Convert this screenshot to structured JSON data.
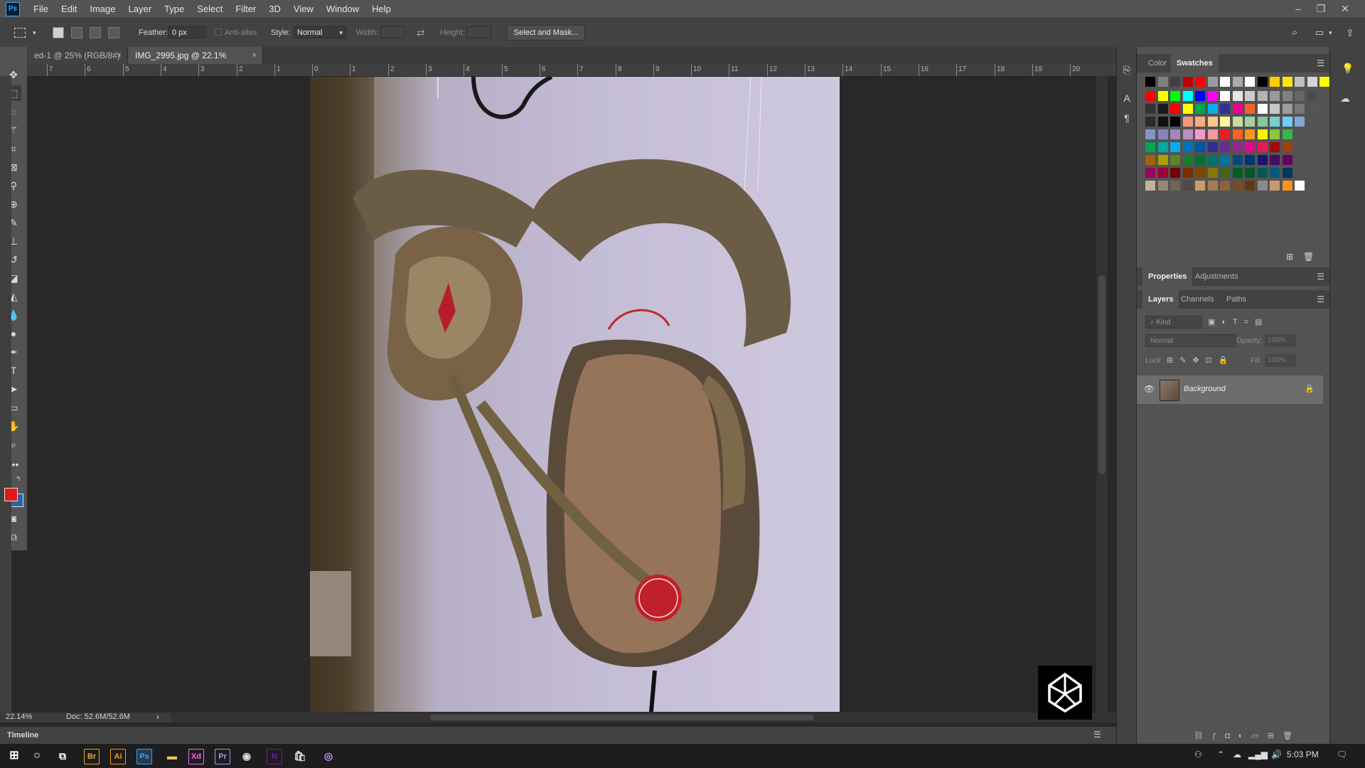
{
  "app": {
    "logo_text": "Ps"
  },
  "menu": [
    "File",
    "Edit",
    "Image",
    "Layer",
    "Type",
    "Select",
    "Filter",
    "3D",
    "View",
    "Window",
    "Help"
  ],
  "window_controls": {
    "minimize": "–",
    "restore": "❐",
    "close": "✕"
  },
  "options_bar": {
    "feather_label": "Feather:",
    "feather_value": "0 px",
    "anti_alias_label": "Anti-alias",
    "style_label": "Style:",
    "style_value": "Normal",
    "width_label": "Width:",
    "height_label": "Height:",
    "select_mask_label": "Select and Mask..."
  },
  "tabs": [
    {
      "label": "ed-1 @ 25% (RGB/8#)",
      "close": "×"
    },
    {
      "label": "IMG_2995.jpg @ 22.1% (RGB/8)",
      "close": "×"
    }
  ],
  "hruler_labels": [
    "7",
    "6",
    "5",
    "4",
    "3",
    "2",
    "1",
    "0",
    "1",
    "2",
    "3",
    "4",
    "5",
    "6",
    "7",
    "8",
    "9",
    "10",
    "11",
    "12",
    "13",
    "14",
    "15",
    "16",
    "17",
    "18",
    "19",
    "20"
  ],
  "status": {
    "zoom": "22.14%",
    "doc": "Doc: 52.6M/52.6M",
    "arrow": "›"
  },
  "timeline": {
    "label": "Timeline"
  },
  "color_panel": {
    "tabs": [
      "Color",
      "Swatches"
    ]
  },
  "swatch_colors": {
    "row1": [
      "#000000",
      "#7f7f7f",
      "#404040",
      "#c00000",
      "#ff0000",
      "#9b9b9b",
      "#ffffff",
      "#aaaaaa",
      "#ffffff",
      "#000000",
      "#ffcc00",
      "#ffe600",
      "#c0c0c0",
      "#d4d4d4",
      "#ffff00"
    ],
    "row2": [
      "#ff0000",
      "#ffff00",
      "#00ff00",
      "#00ffff",
      "#0000ff",
      "#ff00ff",
      "#ffffff",
      "#e6e6e6",
      "#cccccc",
      "#b3b3b3",
      "#999999",
      "#808080",
      "#666666",
      "#4d4d4d"
    ],
    "row3": [
      "#333333",
      "#1a1a1a",
      "#ff0000",
      "#ffff00",
      "#00a651",
      "#00aeef",
      "#2e3192",
      "#ec008c",
      "#f26522",
      "#ffffff",
      "#c7c7c7",
      "#9d9d9d",
      "#777777",
      "#555555"
    ],
    "row4": [
      "#2b2b2b",
      "#111111",
      "#000000",
      "#f7977a",
      "#f9ad81",
      "#fdc68a",
      "#fff79a",
      "#c4df9b",
      "#a2d39c",
      "#82ca9d",
      "#7bcdc8",
      "#6ecff6",
      "#7ea7d8"
    ],
    "row5": [
      "#8493ca",
      "#8882be",
      "#a187be",
      "#bc8dbf",
      "#f49ac2",
      "#f6989d",
      "#ed1c24",
      "#f26522",
      "#f7941d",
      "#fff200",
      "#8dc63f",
      "#39b54a"
    ],
    "row6": [
      "#00a651",
      "#00a99d",
      "#00aeef",
      "#0072bc",
      "#0054a6",
      "#2e3192",
      "#662d91",
      "#92278f",
      "#ec008c",
      "#ed145b",
      "#9e0b0f",
      "#a0410d"
    ],
    "row7": [
      "#a3620a",
      "#aba000",
      "#598527",
      "#197b30",
      "#007236",
      "#00746b",
      "#0076a3",
      "#004a80",
      "#003471",
      "#1b1464",
      "#440e62",
      "#630460"
    ],
    "row8": [
      "#9e005d",
      "#9e0039",
      "#790000",
      "#7b2e00",
      "#7d4900",
      "#827b00",
      "#406618",
      "#005e20",
      "#005826",
      "#005952",
      "#005b7f",
      "#003663"
    ],
    "row9": [
      "#c7b299",
      "#998675",
      "#736357",
      "#534741",
      "#c69c6d",
      "#a67c52",
      "#8c6239",
      "#754c24",
      "#603913",
      "#8a8a8a",
      "#c69c6d",
      "#f7941d",
      "#ffffff"
    ]
  },
  "properties_panel": {
    "tabs": [
      "Properties",
      "Adjustments"
    ]
  },
  "layers_panel": {
    "tabs": [
      "Layers",
      "Channels",
      "Paths"
    ],
    "kind_placeholder": "Kind",
    "blend_mode": "Normal",
    "opacity_label": "Opacity:",
    "opacity_value": "100%",
    "lock_label": "Lock:",
    "fill_label": "Fill:",
    "fill_value": "100%",
    "layers": [
      {
        "name": "Background"
      }
    ]
  },
  "taskbar": {
    "apps": [
      {
        "label": "Br",
        "color": "#e5a230"
      },
      {
        "label": "Ai",
        "color": "#ff9a00"
      },
      {
        "label": "Ps",
        "color": "#31a8ff"
      },
      {
        "label": "Xd",
        "color": "#ff61f6"
      },
      {
        "label": "Pr",
        "color": "#9999ff"
      },
      {
        "label": "N",
        "color": "#7719aa"
      }
    ],
    "time": "5:03 PM"
  }
}
